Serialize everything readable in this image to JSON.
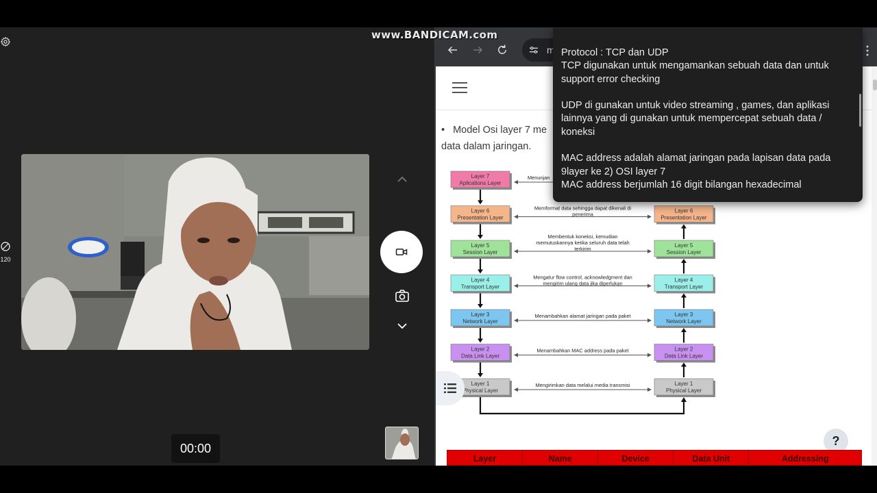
{
  "watermark": "www.BANDICAM.com",
  "camera": {
    "hdr_label": "120",
    "timer": "00:00"
  },
  "browser": {
    "address_partial": "m"
  },
  "page": {
    "paragraph_line1": "Model Osi layer 7 me",
    "paragraph_line2": "data dalam jaringan.",
    "bullet": "•",
    "help_label": "?"
  },
  "diagram": {
    "left_layers": [
      {
        "num": "Layer 7",
        "name": "Aplications Layer",
        "color": "#f07aa8"
      },
      {
        "num": "Layer 6",
        "name": "Presentation Layer",
        "color": "#f5b58a"
      },
      {
        "num": "Layer 5",
        "name": "Session Layer",
        "color": "#9fe39a"
      },
      {
        "num": "Layer 4",
        "name": "Transport Layer",
        "color": "#9af0e8"
      },
      {
        "num": "Layer 3",
        "name": "Network Layer",
        "color": "#7cc6ef"
      },
      {
        "num": "Layer 2",
        "name": "Data Link Layer",
        "color": "#c890ef"
      },
      {
        "num": "Layer 1",
        "name": "Physical Layer",
        "color": "#c9c9c9"
      }
    ],
    "right_layers": [
      {
        "num": "Layer 6",
        "name": "Presentation Layer",
        "color": "#f5b58a"
      },
      {
        "num": "Layer 5",
        "name": "Session Layer",
        "color": "#9fe39a"
      },
      {
        "num": "Layer 4",
        "name": "Transport Layer",
        "color": "#9af0e8"
      },
      {
        "num": "Layer 3",
        "name": "Network Layer",
        "color": "#7cc6ef"
      },
      {
        "num": "Layer 2",
        "name": "Data Link Layer",
        "color": "#c890ef"
      },
      {
        "num": "Layer 1",
        "name": "Physical Layer",
        "color": "#c9c9c9"
      }
    ],
    "descriptions": [
      [
        "Menunjan"
      ],
      [
        "Memformat data sehingga dapat dikenali di",
        "penerima"
      ],
      [
        "Membentuk koneksi, kemudian",
        "memutuskannya ketika seluruh data telah",
        "terkirim"
      ],
      [
        "Mengatur flow control, acknowledgment dan",
        "mengirim ulang data jika diperlukan"
      ],
      [
        "Menambahkan alamat jaringan pada paket"
      ],
      [
        "Menambahkan MAC address pada paket"
      ],
      [
        "Mengirimkan data melalui media transmisi"
      ]
    ]
  },
  "table": {
    "headers": [
      "Layer",
      "Name",
      "Device",
      "Data Unit",
      "Addressing"
    ]
  },
  "notes": {
    "text": "Protocol : TCP dan UDP\nTCP digunakan untuk mengamankan sebuah data dan untuk support error checking\n\nUDP di gunakan untuk video streaming , games, dan aplikasi lainnya yang di gunakan untuk mempercepat sebuah data / koneksi\n\nMAC address adalah alamat jaringan pada lapisan data pada 9layer ke 2) OSI layer 7\nMAC address berjumlah 16 digit bilangan hexadecimal\n\nIP address digunakan untuk komunikasi antar perangkat jaringan"
  }
}
